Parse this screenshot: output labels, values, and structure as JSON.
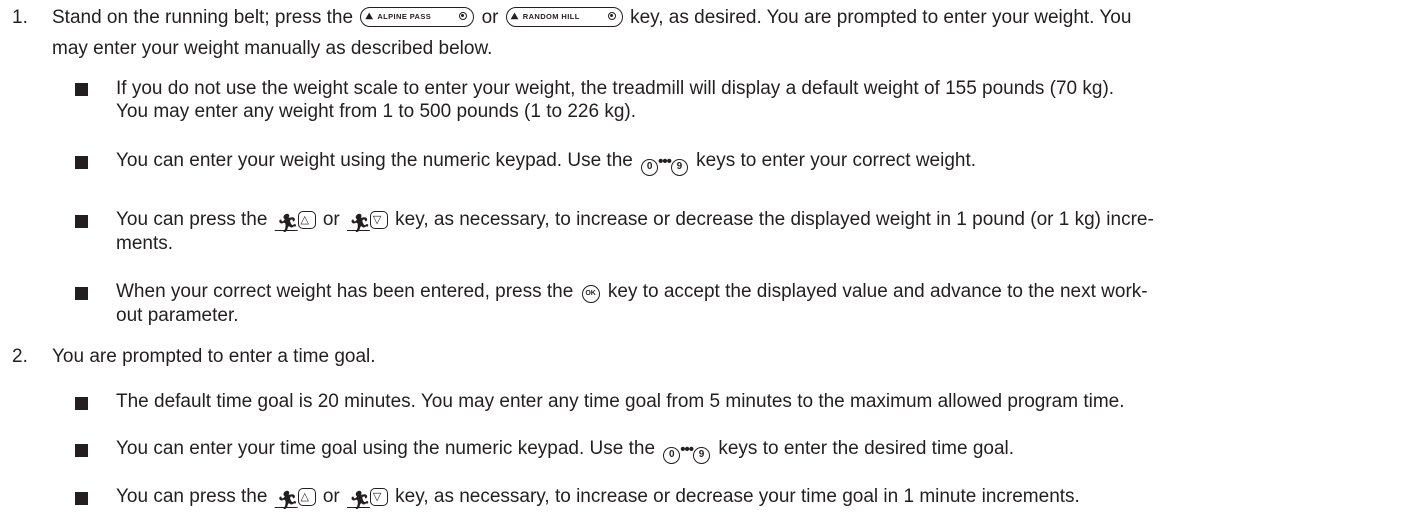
{
  "steps": [
    {
      "number": "1.",
      "line1_a": "Stand on the running belt; press the",
      "key_alpine": "ALPINE PASS",
      "or": "or",
      "key_random": "RANDOM HILL",
      "line1_b": "key, as desired. You are prompted to enter your weight. You",
      "line2": "may enter your weight manually as described below.",
      "bullets": [
        {
          "line1": "If you do not use the weight scale to enter your weight, the treadmill will display a default weight of 155 pounds (70 kg).",
          "line2": "You may enter any weight from 1 to 500 pounds (1 to 226 kg)."
        },
        {
          "line1_a": "You can enter your weight using the numeric keypad. Use the",
          "line1_b": "keys to enter your correct weight."
        },
        {
          "line1_a": "You can press the",
          "or": "or",
          "line1_b": "key, as necessary, to increase or decrease the displayed weight in 1 pound (or 1 kg) incre-",
          "line2": "ments."
        },
        {
          "line1_a": "When your correct weight has been entered, press the",
          "line1_b": "key to accept the displayed value and advance to the next work-",
          "line2": "out parameter."
        }
      ]
    },
    {
      "number": "2.",
      "line1": "You are prompted to enter a time goal.",
      "bullets": [
        {
          "line1": "The default time goal is 20 minutes. You may enter any time goal from 5 minutes to the maximum allowed program time."
        },
        {
          "line1_a": "You can enter your time goal using the numeric keypad. Use the",
          "line1_b": "keys to enter the desired time goal."
        },
        {
          "line1_a": "You can press the",
          "or": "or",
          "line1_b": "key, as necessary, to increase or decrease your time goal in 1 minute increments."
        }
      ]
    }
  ],
  "icons": {
    "numkey_start": "0",
    "numkey_end": "9",
    "numkey_dots": "•••",
    "ok": "OK"
  }
}
